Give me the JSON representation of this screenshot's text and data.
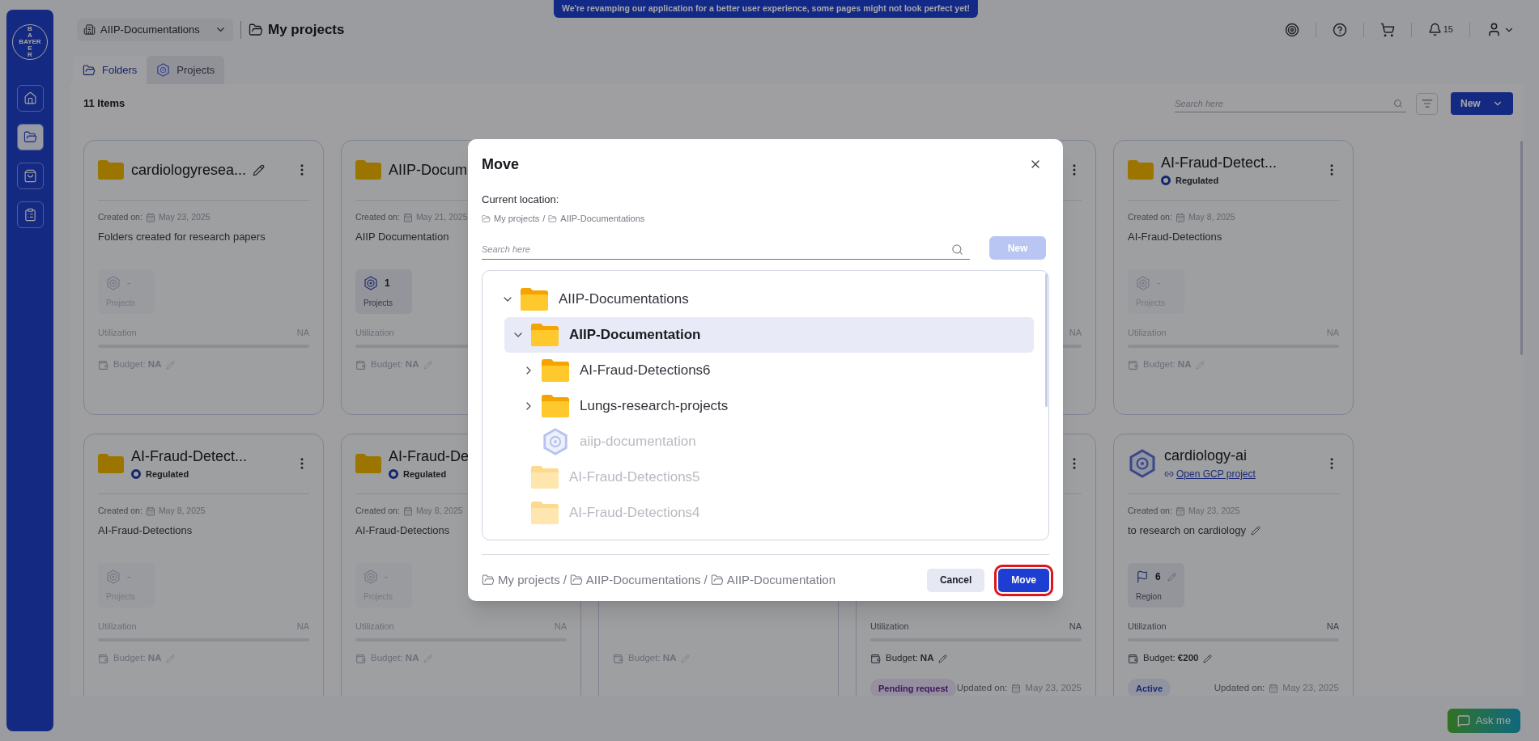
{
  "banner": "We're revamping our application for a better user experience, some pages might not look perfect yet!",
  "sidebar": {
    "logo": {
      "top": "BA",
      "horizontal": "BAYER",
      "bottom": "ER"
    },
    "items": [
      {
        "kind": "home",
        "selected": false
      },
      {
        "kind": "folders",
        "selected": true
      },
      {
        "kind": "bag",
        "selected": false
      },
      {
        "kind": "clipboard",
        "selected": false
      }
    ]
  },
  "header": {
    "workspace": "AIIP-Documentations",
    "title": "My projects",
    "notifications": "15"
  },
  "tabs": [
    {
      "label": "Folders",
      "kind": "folder",
      "selected": true
    },
    {
      "label": "Projects",
      "kind": "project",
      "selected": false
    }
  ],
  "toolbar": {
    "count": "11 Items",
    "search_placeholder": "Search here",
    "new_button": "New"
  },
  "cards": [
    {
      "kind": "folder",
      "menu": true,
      "title": "cardiologyresea...",
      "title_editable": true,
      "created_label": "Created on:",
      "created": "May 23, 2025",
      "description": "Folders created for research papers",
      "stat": {
        "kind": "projects",
        "value": "-",
        "label": "Projects",
        "disabled": true
      },
      "utilization": {
        "label": "Utilization",
        "value": "NA"
      },
      "budget": "Budget: **NA**"
    },
    {
      "kind": "folder",
      "menu": false,
      "title": "AIIP-Docum",
      "created_label": "Created on:",
      "created": "May 21, 2025",
      "description": "AIIP Documentation",
      "stat": {
        "kind": "projects",
        "value": "1",
        "label": "Projects",
        "disabled": false
      },
      "utilization": {
        "label": "Utilization"
      },
      "budget": "Budget: **NA**"
    },
    {
      "kind": "folder",
      "menu": true,
      "utilization": {
        "value": "NA"
      }
    },
    {
      "kind": "folder",
      "menu": true,
      "title": "AI-Fraud-Detect...",
      "regulated": "Regulated",
      "created_label": "Created on:",
      "created": "May 8, 2025",
      "description": "AI-Fraud-Detections",
      "stat": {
        "kind": "projects",
        "value": "-",
        "label": "Projects",
        "disabled": true
      },
      "utilization": {
        "label": "Utilization",
        "value": "NA"
      },
      "budget": "Budget: **NA**"
    },
    {
      "kind": "folder",
      "menu": true,
      "title": "AI-Fraud-Detect...",
      "regulated": "Regulated",
      "created_label": "Created on:",
      "created": "May 8, 2025",
      "description": "AI-Fraud-Detections",
      "stat": {
        "kind": "projects",
        "value": "-",
        "label": "Projects",
        "disabled": true
      },
      "utilization": {
        "label": "Utilization",
        "value": "NA"
      },
      "budget": "Budget: **NA**"
    },
    {
      "kind": "folder",
      "menu": false,
      "title": "AI-Fraud-De",
      "regulated": "Regulated",
      "created_label": "Created on:",
      "created": "May 8, 2025",
      "description": "AI-Fraud-Detections",
      "stat": {
        "kind": "projects",
        "value": "-",
        "label": "Projects",
        "disabled": true
      },
      "utilization": {
        "label": "Utilization",
        "value": "NA"
      },
      "budget": "Budget: **NA**"
    },
    {
      "kind": "folder",
      "menu": false,
      "budget": "Budget: **NA**"
    },
    {
      "kind": "project",
      "menu": true,
      "utilization": {
        "label": "Utilization",
        "value": "NA"
      },
      "budget": "Budget: **NA**",
      "status": {
        "kind": "pending",
        "label": "Pending request"
      },
      "updated_label": "Updated on:",
      "updated": "May 23, 2025"
    },
    {
      "kind": "project",
      "menu": true,
      "title": "cardiology-ai",
      "link": "Open GCP project",
      "created_label": "Created on:",
      "created": "May 23, 2025",
      "description": "to research on cardiology",
      "description_editable": true,
      "stat": {
        "kind": "region",
        "value": "6",
        "label": "Region",
        "disabled": false,
        "editable": true
      },
      "utilization": {
        "label": "Utilization",
        "value": "NA"
      },
      "budget": "Budget: **€200**",
      "status": {
        "kind": "active",
        "label": "Active"
      },
      "updated_label": "Updated on:",
      "updated": "May 23, 2025"
    }
  ],
  "modal": {
    "title": "Move",
    "location_label": "Current location:",
    "location": {
      "separator": "/",
      "items": [
        "My projects",
        "AIIP-Documentations"
      ]
    },
    "search_placeholder": "Search here",
    "new_button": {
      "label": "New",
      "disabled": true
    },
    "tree": [
      {
        "kind": "folder",
        "label": "AIIP-Documentations",
        "expanded": true,
        "selected": false,
        "disabled": false,
        "children": [
          {
            "kind": "folder",
            "label": "AIIP-Documentation",
            "expanded": true,
            "selected": true,
            "disabled": false,
            "children": [
              {
                "kind": "folder",
                "label": "AI-Fraud-Detections6",
                "expanded": false,
                "selected": false,
                "disabled": false
              },
              {
                "kind": "folder",
                "label": "Lungs-research-projects",
                "expanded": false,
                "selected": false,
                "disabled": false
              },
              {
                "kind": "project",
                "label": "aiip-documentation",
                "selected": false,
                "disabled": true
              }
            ]
          },
          {
            "kind": "folder",
            "label": "AI-Fraud-Detections5",
            "selected": false,
            "disabled": true
          },
          {
            "kind": "folder",
            "label": "AI-Fraud-Detections4",
            "selected": false,
            "disabled": true
          }
        ]
      }
    ],
    "destination": {
      "separator": "/",
      "items": [
        "My projects",
        "AIIP-Documentations",
        "AIIP-Documentation"
      ]
    },
    "buttons": [
      {
        "label": "Cancel",
        "kind": "secondary",
        "highlighted": false
      },
      {
        "label": "Move",
        "kind": "primary",
        "highlighted": true
      }
    ]
  },
  "assistant": {
    "label": "Ask me"
  }
}
